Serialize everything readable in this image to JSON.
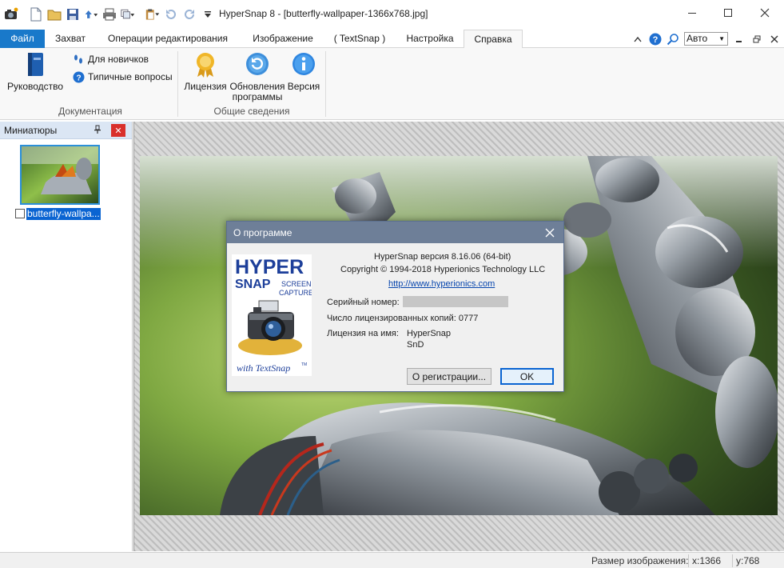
{
  "window": {
    "title": "HyperSnap 8 - [butterfly-wallpaper-1366x768.jpg]"
  },
  "quick_access": [
    "hypersnap-logo-icon",
    "new-file-icon",
    "open-folder-icon",
    "save-icon",
    "upload-icon",
    "print-icon",
    "copy-icon",
    "paste-icon",
    "undo-icon",
    "redo-icon",
    "customize-arrow-icon"
  ],
  "ribbon": {
    "tabs": [
      {
        "label": "Файл"
      },
      {
        "label": "Захват"
      },
      {
        "label": "Операции редактирования"
      },
      {
        "label": "Изображение"
      },
      {
        "label": "( TextSnap )"
      },
      {
        "label": "Настройка"
      },
      {
        "label": "Справка"
      }
    ],
    "zoom_value": "Авто",
    "groups": {
      "docs": {
        "label": "Документация",
        "manual": "Руководство",
        "beginners": "Для новичков",
        "faq": "Типичные вопросы"
      },
      "about": {
        "label": "Общие сведения",
        "license": "Лицензия",
        "updates_line1": "Обновления",
        "updates_line2": "программы",
        "version": "Версия"
      }
    }
  },
  "thumbs": {
    "title": "Миниатюры",
    "item_caption": "butterfly-wallpa..."
  },
  "dialog": {
    "title": "О программе",
    "version_line": "HyperSnap версия 8.16.06 (64-bit)",
    "copyright": "Copyright © 1994-2018 Hyperionics Technology LLC",
    "url": "http://www.hyperionics.com",
    "serial_label": "Серийный номер:",
    "copies_label": "Число лицензированных копий: 0777",
    "licensee_label": "Лицензия на имя:",
    "licensee_name1": "HyperSnap",
    "licensee_name2": "SnD",
    "register_button": "О регистрации...",
    "ok_button": "OK",
    "logo": {
      "hyper": "HYPER",
      "snap": "SNAP",
      "screen": "SCREEN",
      "capture": "CAPTURE",
      "with": "with TextSnap",
      "tm": "TM"
    }
  },
  "status": {
    "size_label": "Размер изображения:",
    "x": "x:1366",
    "y": "y:768"
  },
  "colors": {
    "file_tab": "#1979ca",
    "dialog_title": "#6e7f98",
    "selection": "#0a64d2"
  }
}
